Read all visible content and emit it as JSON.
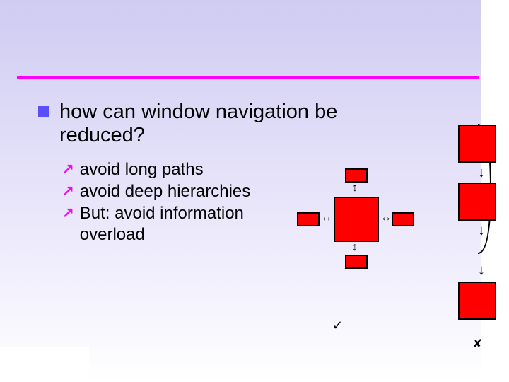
{
  "slide": {
    "heading": "how can window navigation be reduced?",
    "bullets": [
      "avoid long paths",
      "avoid deep hierarchies",
      "But: avoid information overload"
    ],
    "marks": {
      "check": "✓",
      "cross": "✘"
    }
  },
  "icons": {
    "square_bullet": "square-bullet",
    "arrow_bullet": "↗",
    "updown": "↕",
    "leftright": "↔",
    "down": "↓"
  }
}
